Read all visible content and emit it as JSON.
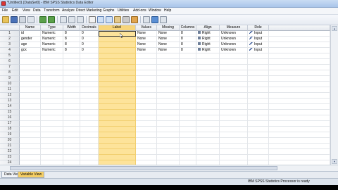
{
  "window": {
    "title": "*Untitled1 [DataSet0] - IBM SPSS Statistics Data Editor"
  },
  "menu": [
    "File",
    "Edit",
    "View",
    "Data",
    "Transform",
    "Analyze",
    "Direct Marketing",
    "Graphs",
    "Utilities",
    "Add-ons",
    "Window",
    "Help"
  ],
  "toolbar": {
    "icons": [
      "open-icon",
      "save-icon",
      "print-icon",
      "dialog-recall-icon",
      "undo-icon",
      "redo-icon",
      "goto-case-icon",
      "goto-variable-icon",
      "variables-icon",
      "find-icon",
      "insert-cases-icon",
      "insert-variable-icon",
      "split-file-icon",
      "weight-cases-icon",
      "select-cases-icon",
      "value-labels-icon",
      "use-sets-icon",
      "spell-icon"
    ]
  },
  "columns": [
    "Name",
    "Type",
    "Width",
    "Decimals",
    "Label",
    "Values",
    "Missing",
    "Columns",
    "Align",
    "Measure",
    "Role"
  ],
  "rows": [
    {
      "num": "1",
      "name": "id",
      "type": "Numeric",
      "width": "8",
      "decimals": "0",
      "label": "",
      "values": "None",
      "missing": "None",
      "columns": "8",
      "align": "Right",
      "measure": "Unknown",
      "role": "Input"
    },
    {
      "num": "2",
      "name": "gender",
      "type": "Numeric",
      "width": "8",
      "decimals": "0",
      "label": "",
      "values": "None",
      "missing": "None",
      "columns": "8",
      "align": "Right",
      "measure": "Unknown",
      "role": "Input"
    },
    {
      "num": "3",
      "name": "age",
      "type": "Numeric",
      "width": "8",
      "decimals": "0",
      "label": "",
      "values": "None",
      "missing": "None",
      "columns": "8",
      "align": "Right",
      "measure": "Unknown",
      "role": "Input"
    },
    {
      "num": "4",
      "name": "gcx",
      "type": "Numeric",
      "width": "8",
      "decimals": "0",
      "label": "",
      "values": "None",
      "missing": "None",
      "columns": "8",
      "align": "Right",
      "measure": "Unknown",
      "role": "Input"
    }
  ],
  "empty_row_numbers": [
    "5",
    "6",
    "7",
    "8",
    "9",
    "10",
    "11",
    "12",
    "13",
    "14",
    "15",
    "16",
    "17",
    "18",
    "19",
    "20",
    "21",
    "22",
    "23",
    "24"
  ],
  "tabs": [
    {
      "label": "Data View",
      "active": false
    },
    {
      "label": "Variable View",
      "active": true
    }
  ],
  "status": "IBM SPSS Statistics Processor is ready",
  "colors": {
    "selected_column": "#fde39a",
    "active_tab": "#f6cf66"
  }
}
